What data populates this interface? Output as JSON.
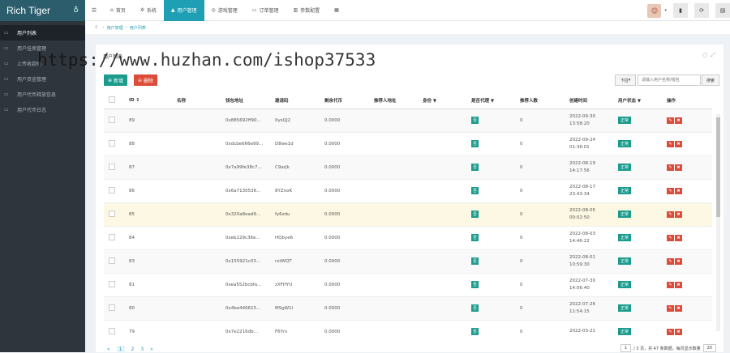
{
  "app": {
    "logo": "Rich Tiger"
  },
  "sidebar": {
    "items": [
      {
        "label": "用户列表",
        "active": true
      },
      {
        "label": "用户挂卖管理",
        "active": false
      },
      {
        "label": "上传收款码",
        "active": false
      },
      {
        "label": "用户资金管理",
        "active": false
      },
      {
        "label": "用户代币释放信息",
        "active": false
      },
      {
        "label": "用户代币日志",
        "active": false
      }
    ]
  },
  "nav": {
    "items": [
      {
        "label": "首页",
        "icon": "home-icon"
      },
      {
        "label": "系统",
        "icon": "gear-icon"
      },
      {
        "label": "用户管理",
        "icon": "user-icon",
        "active": true
      },
      {
        "label": "游戏管理",
        "icon": "gamepad-icon"
      },
      {
        "label": "订单管理",
        "icon": "order-icon"
      },
      {
        "label": "参数配置",
        "icon": "config-icon"
      }
    ]
  },
  "breadcrumb": {
    "items": [
      "用户管理",
      "用户列表"
    ]
  },
  "watermark": "https://www.huzhan.com/ishop37533",
  "panel": {
    "title": "用户列表",
    "add_label": "新增",
    "delete_label": "删除",
    "dropdown_label": "下拉",
    "search_placeholder": "请输入用户名称/钱包",
    "search_label": "搜索"
  },
  "table": {
    "headers": [
      "",
      "ID ⇕",
      "名称",
      "钱包地址",
      "邀请码",
      "剩余代币",
      "推荐人地址",
      "身份 ▼",
      "是否代理 ▼",
      "推荐人数",
      "创建时间",
      "用户状态 ▼",
      "操作"
    ],
    "rows": [
      {
        "id": "89",
        "name": "",
        "wallet": "0x885692ff90...",
        "code": "0ysQJ2",
        "tokens": "0.0000",
        "referrer": "",
        "role": "",
        "agent": "否",
        "ref_count": "0",
        "date": "2022-09-30",
        "time": "13:58:20",
        "status": "正常"
      },
      {
        "id": "88",
        "name": "",
        "wallet": "0xdcbe666e99...",
        "code": "D8we1d",
        "tokens": "0.0000",
        "referrer": "",
        "role": "",
        "agent": "否",
        "ref_count": "0",
        "date": "2022-09-24",
        "time": "01:36:01",
        "status": "正常"
      },
      {
        "id": "87",
        "name": "",
        "wallet": "0x7a99fe38c7...",
        "code": "C9arJk",
        "tokens": "0.0000",
        "referrer": "",
        "role": "",
        "agent": "否",
        "ref_count": "0",
        "date": "2022-08-19",
        "time": "14:17:56",
        "status": "正常"
      },
      {
        "id": "86",
        "name": "",
        "wallet": "0x6a7130536...",
        "code": "8YZnoK",
        "tokens": "0.0000",
        "referrer": "",
        "role": "",
        "agent": "否",
        "ref_count": "0",
        "date": "2022-08-17",
        "time": "23:43:34",
        "status": "正常"
      },
      {
        "id": "85",
        "name": "",
        "wallet": "0x320a8ead9...",
        "code": "fy6zdu",
        "tokens": "0.0000",
        "referrer": "",
        "role": "",
        "agent": "否",
        "ref_count": "0",
        "date": "2022-08-05",
        "time": "00:02:50",
        "status": "正常"
      },
      {
        "id": "84",
        "name": "",
        "wallet": "0xeb129c36e...",
        "code": "HQbye6",
        "tokens": "0.0000",
        "referrer": "",
        "role": "",
        "agent": "否",
        "ref_count": "0",
        "date": "2022-08-03",
        "time": "14:46:22",
        "status": "正常"
      },
      {
        "id": "83",
        "name": "",
        "wallet": "0x155921c03...",
        "code": "rxtWQT",
        "tokens": "0.0000",
        "referrer": "",
        "role": "",
        "agent": "否",
        "ref_count": "0",
        "date": "2022-08-01",
        "time": "10:59:30",
        "status": "正常"
      },
      {
        "id": "81",
        "name": "",
        "wallet": "0xea552bcbfa...",
        "code": "zXFHYU",
        "tokens": "0.0000",
        "referrer": "",
        "role": "",
        "agent": "否",
        "ref_count": "0",
        "date": "2022-07-30",
        "time": "14:06:40",
        "status": "正常"
      },
      {
        "id": "80",
        "name": "",
        "wallet": "0x4be446615...",
        "code": "MSgW1l",
        "tokens": "0.0000",
        "referrer": "",
        "role": "",
        "agent": "否",
        "ref_count": "0",
        "date": "2022-07-26",
        "time": "11:54:15",
        "status": "正常"
      },
      {
        "id": "79",
        "name": "",
        "wallet": "0x7e2216db...",
        "code": "F6Yrs",
        "tokens": "0.0000",
        "referrer": "",
        "role": "",
        "agent": "否",
        "ref_count": "0",
        "date": "2022-03-21",
        "time": "",
        "status": "正常"
      }
    ]
  },
  "pager": {
    "pages": [
      "«",
      "1",
      "2",
      "3",
      "»"
    ],
    "current": "1",
    "info_input": "1",
    "info_text": "/ 3 页，共 47 条数据，每页显示数量",
    "page_size": "20"
  }
}
